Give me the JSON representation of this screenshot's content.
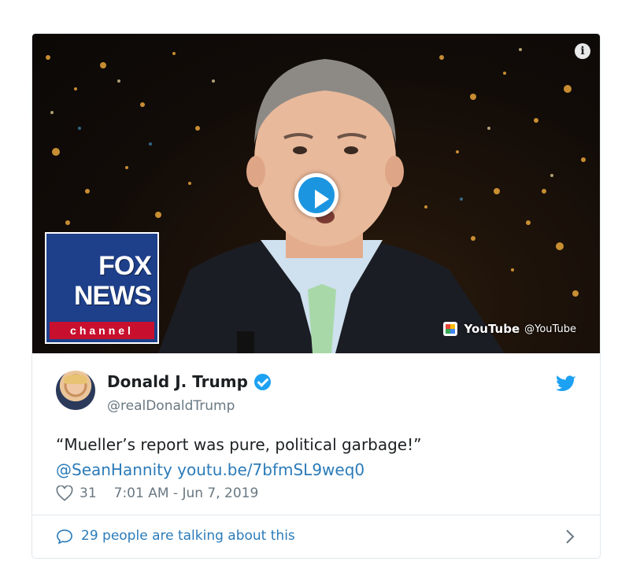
{
  "media": {
    "logo_line1": "FOX",
    "logo_line2": "NEWS",
    "logo_line3": "channel",
    "yt_name": "YouTube",
    "yt_handle": "@YouTube"
  },
  "tweet": {
    "author_name": "Donald J. Trump",
    "author_handle": "@realDonaldTrump",
    "text": "“Mueller’s report was pure, political garbage!”",
    "mention": "@SeanHannity",
    "link": "youtu.be/7bfmSL9weq0",
    "like_count": "31",
    "timestamp": "7:01 AM - Jun 7, 2019"
  },
  "footer": {
    "talking_text": "29 people are talking about this"
  },
  "colors": {
    "link": "#2b7bb9",
    "twitter_blue": "#1da1f2",
    "meta_gray": "#697882"
  }
}
